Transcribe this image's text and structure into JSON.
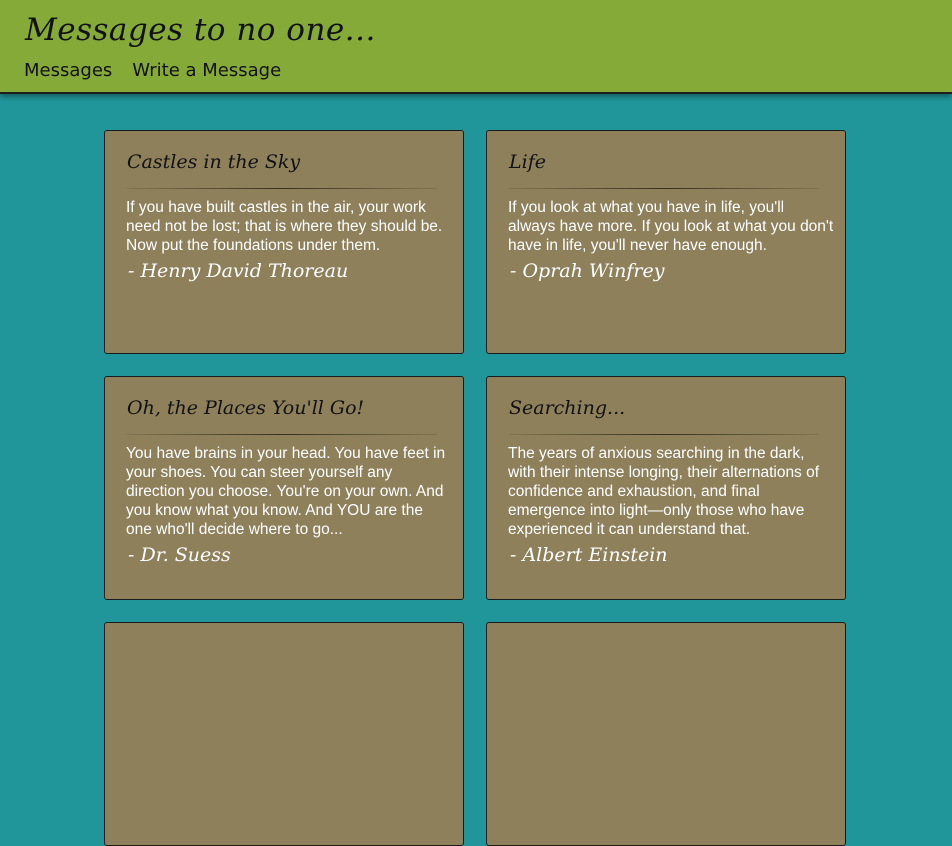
{
  "site": {
    "title": "Messages to no one..."
  },
  "nav": [
    {
      "label": "Messages"
    },
    {
      "label": "Write a Message"
    }
  ],
  "cards": [
    {
      "title": "Castles in the Sky",
      "quote": "If you have built castles in the air, your work need not be lost; that is where they should be. Now put the foundations under them.",
      "author": "- Henry David Thoreau"
    },
    {
      "title": "Life",
      "quote": "If you look at what you have in life, you'll always have more. If you look at what you don't have in life, you'll never have enough.",
      "author": "- Oprah Winfrey"
    },
    {
      "title": "Oh, the Places You'll Go!",
      "quote": "You have brains in your head. You have feet in your shoes. You can steer yourself any direction you choose. You're on your own. And you know what you know. And YOU are the one who'll decide where to go...",
      "author": "- Dr. Suess"
    },
    {
      "title": "Searching...",
      "quote": "The years of anxious searching in the dark, with their intense longing, their alternations of confidence and exhaustion, and final emergence into light—only those who have experienced it can understand that.",
      "author": "- Albert Einstein"
    },
    {
      "title": "",
      "quote": "",
      "author": ""
    },
    {
      "title": "",
      "quote": "",
      "author": ""
    }
  ],
  "colors": {
    "header_bg": "#85aa37",
    "page_bg": "#21969a",
    "card_bg": "#8f805c"
  }
}
